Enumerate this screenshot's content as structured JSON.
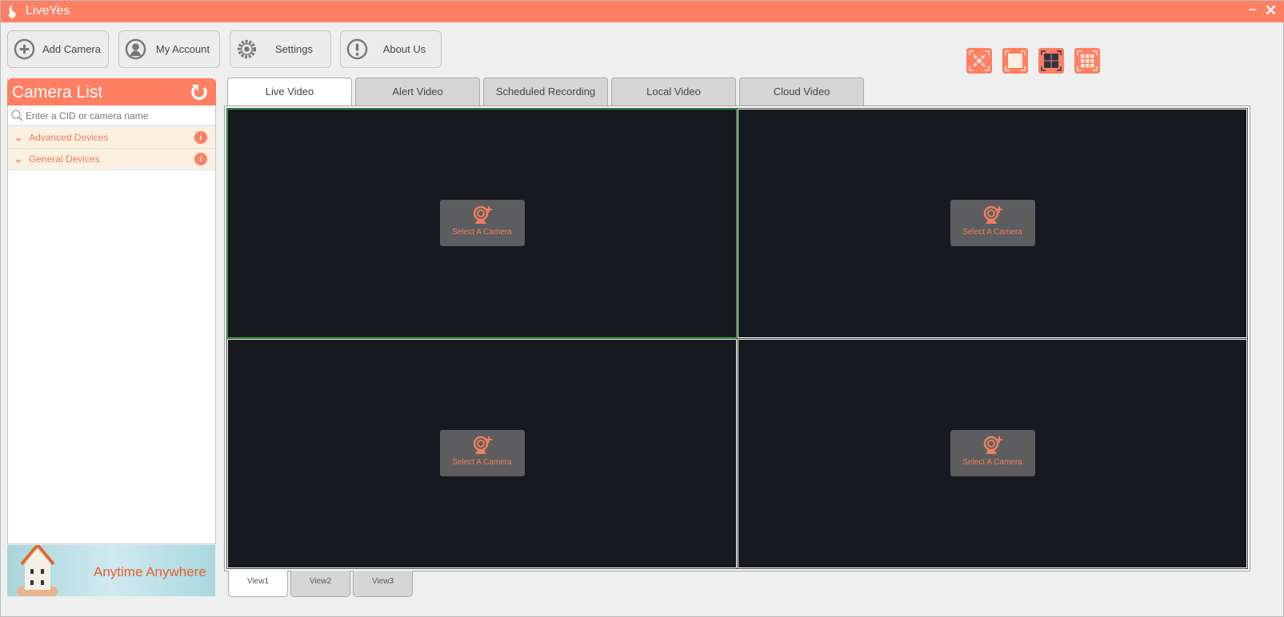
{
  "app": {
    "title": "LiveYes"
  },
  "toolbar": [
    {
      "label": "Add Camera",
      "icon": "plus-circle-icon"
    },
    {
      "label": "My Account",
      "icon": "user-icon"
    },
    {
      "label": "Settings",
      "icon": "gear-icon"
    },
    {
      "label": "About Us",
      "icon": "exclamation-icon"
    }
  ],
  "layouts": [
    {
      "name": "fullscreen"
    },
    {
      "name": "single"
    },
    {
      "name": "quad",
      "selected": true
    },
    {
      "name": "nine"
    }
  ],
  "sidebar": {
    "title": "Camera List",
    "search_placeholder": "Enter a CID or camera name",
    "groups": [
      {
        "label": "Advanced Devices"
      },
      {
        "label": "General Devices"
      }
    ],
    "banner": "Anytime Anywhere"
  },
  "tabs": [
    {
      "label": "Live Video",
      "active": true
    },
    {
      "label": "Alert Video"
    },
    {
      "label": "Scheduled Recording"
    },
    {
      "label": "Local Video"
    },
    {
      "label": "Cloud Video"
    }
  ],
  "cells": [
    {
      "label": "Select A Camera"
    },
    {
      "label": "Select A Camera"
    },
    {
      "label": "Select A Camera"
    },
    {
      "label": "Select A Camera"
    }
  ],
  "views": [
    {
      "label": "View1",
      "active": true
    },
    {
      "label": "View2"
    },
    {
      "label": "View3"
    }
  ],
  "colors": {
    "accent": "#ff7f63",
    "video_bg": "#171920",
    "selected_border": "#27c427"
  }
}
